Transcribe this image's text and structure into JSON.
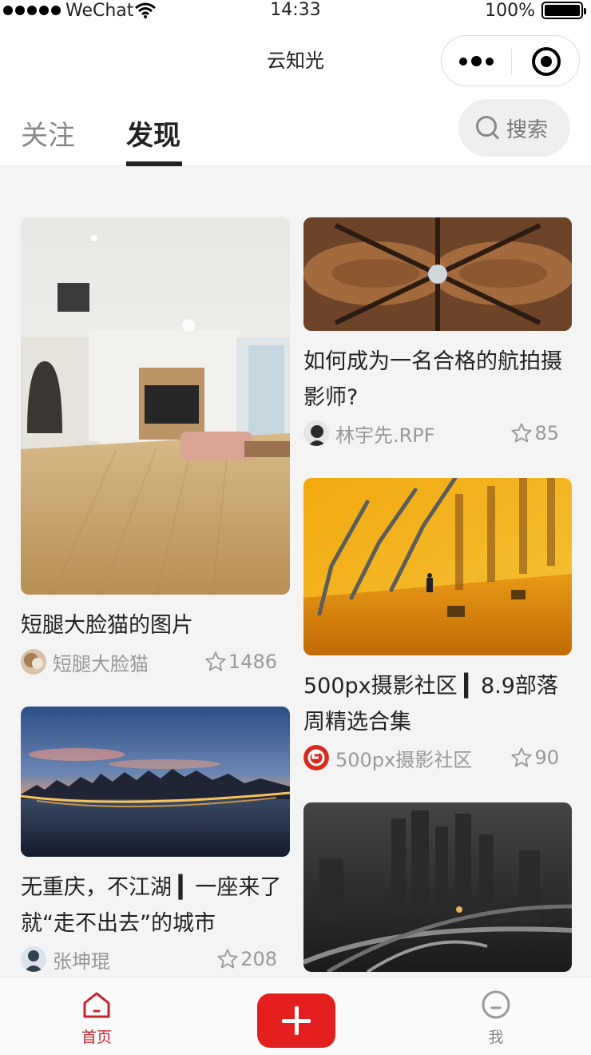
{
  "status_bar": {
    "carrier": "WeChat",
    "time": "14:33",
    "battery": "100%"
  },
  "navbar": {
    "title": "云知光"
  },
  "tabs": {
    "follow": "关注",
    "discover": "发现",
    "search_label": "搜索"
  },
  "feed": {
    "left": [
      {
        "title": "短腿大脸猫的图片",
        "author": "短腿大脸猫",
        "likes": "1486",
        "image": "living-room-photo"
      },
      {
        "title_line1": "无重庆，不江湖 ▎一座来了",
        "title_line2": "就“走不出去”的城市",
        "author": "张坤琨",
        "likes": "208",
        "image": "city-skyline-sunset-photo"
      }
    ],
    "right": [
      {
        "title_line1": "如何成为一名合格的航拍摄",
        "title_line2": "影师?",
        "author": "林宇先.RPF",
        "likes": "85",
        "image": "aerial-rust-pattern-photo"
      },
      {
        "title_line1": "500px摄影社区 ▎8.9部落",
        "title_line2": "周精选合集",
        "author": "500px摄影社区",
        "likes": "90",
        "image": "forks-shadow-photo"
      },
      {
        "image": "night-city-overpass-photo"
      }
    ]
  },
  "tabbar": {
    "home": "首页",
    "me": "我"
  },
  "colors": {
    "accent": "#e3201f",
    "home_active": "#c8232c",
    "muted": "#999999"
  }
}
